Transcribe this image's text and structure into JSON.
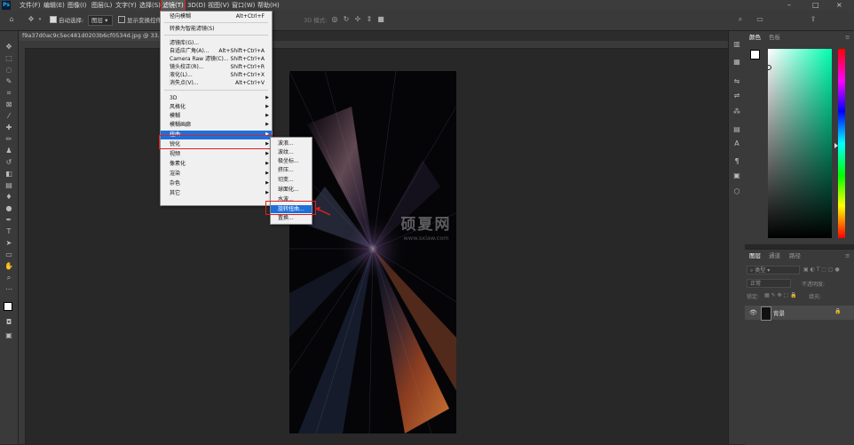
{
  "menubar": {
    "app_icon": "Ps",
    "items": [
      "文件(F)",
      "编辑(E)",
      "图像(I)",
      "图层(L)",
      "文字(Y)",
      "选择(S)",
      "滤镜(T)",
      "3D(D)",
      "视图(V)",
      "窗口(W)",
      "帮助(H)"
    ],
    "window_controls": [
      "–",
      "□",
      "×"
    ]
  },
  "options": {
    "auto_select_label": "自动选择:",
    "layer_dropdown": "图层",
    "show_transform_label": "显示变换控件",
    "mode_3d": "3D 模式:"
  },
  "document_tab": "f9a37d0ac9c5ec481d0203b6cf0534d.jpg @ 33.3%(RGB/8)",
  "filter_menu": {
    "items": [
      {
        "label": "径向模糊",
        "shortcut": "Alt+Ctrl+F"
      },
      {
        "label": "转换为智能滤镜(S)",
        "shortcut": ""
      },
      {
        "label": "滤镜库(G)...",
        "shortcut": ""
      },
      {
        "label": "自适应广角(A)...",
        "shortcut": "Alt+Shift+Ctrl+A"
      },
      {
        "label": "Camera Raw 滤镜(C)...",
        "shortcut": "Shift+Ctrl+A"
      },
      {
        "label": "镜头校正(R)...",
        "shortcut": "Shift+Ctrl+R"
      },
      {
        "label": "液化(L)...",
        "shortcut": "Shift+Ctrl+X"
      },
      {
        "label": "消失点(V)...",
        "shortcut": "Alt+Ctrl+V"
      },
      {
        "label": "3D",
        "shortcut": ""
      },
      {
        "label": "风格化",
        "shortcut": ""
      },
      {
        "label": "模糊",
        "shortcut": ""
      },
      {
        "label": "模糊画廊",
        "shortcut": ""
      },
      {
        "label": "扭曲",
        "shortcut": ""
      },
      {
        "label": "锐化",
        "shortcut": ""
      },
      {
        "label": "视频",
        "shortcut": ""
      },
      {
        "label": "像素化",
        "shortcut": ""
      },
      {
        "label": "渲染",
        "shortcut": ""
      },
      {
        "label": "杂色",
        "shortcut": ""
      },
      {
        "label": "其它",
        "shortcut": ""
      }
    ]
  },
  "distort_submenu": {
    "items": [
      "波浪...",
      "波纹...",
      "极坐标...",
      "挤压...",
      "切变...",
      "球面化...",
      "水波...",
      "旋转扭曲...",
      "置换..."
    ]
  },
  "watermark": {
    "title": "硕夏网",
    "url": "www.sxiaw.com"
  },
  "color_panel": {
    "tabs": [
      "颜色",
      "色板"
    ]
  },
  "layers_panel": {
    "tabs": [
      "图层",
      "通道",
      "路径"
    ],
    "kind_filter": "类型",
    "blend_mode": "正常",
    "opacity_label": "不透明度:",
    "lock_label": "锁定:",
    "fill_label": "填充:",
    "layer_name": "背景"
  },
  "colors": {
    "highlight": "#1e6fd9",
    "red_box": "#e02020"
  }
}
